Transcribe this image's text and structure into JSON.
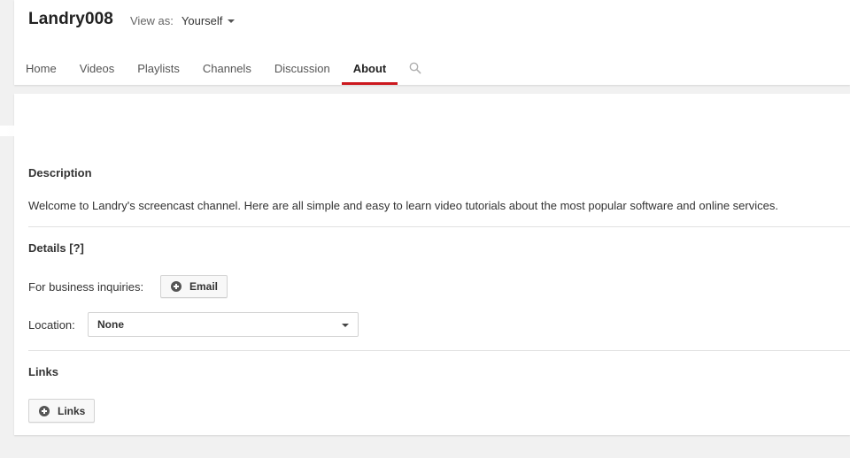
{
  "header": {
    "channel_name": "Landry008",
    "view_as_label": "View as:",
    "view_as_value": "Yourself"
  },
  "tabs": [
    {
      "label": "Home",
      "active": false
    },
    {
      "label": "Videos",
      "active": false
    },
    {
      "label": "Playlists",
      "active": false
    },
    {
      "label": "Channels",
      "active": false
    },
    {
      "label": "Discussion",
      "active": false
    },
    {
      "label": "About",
      "active": true
    }
  ],
  "about": {
    "description_heading": "Description",
    "description_text": "Welcome to Landry's screencast channel. Here are all simple and easy to learn video tutorials about the most popular software and online services.",
    "details_heading": "Details [?]",
    "business_label": "For business inquiries:",
    "email_button": "Email",
    "location_label": "Location:",
    "location_value": "None",
    "links_heading": "Links",
    "links_button": "Links"
  },
  "colors": {
    "accent": "#cc181e",
    "background": "#f1f1f1"
  },
  "icons": {
    "search": "search-icon",
    "add": "plus-circle-icon",
    "dropdown": "caret-down-icon"
  }
}
